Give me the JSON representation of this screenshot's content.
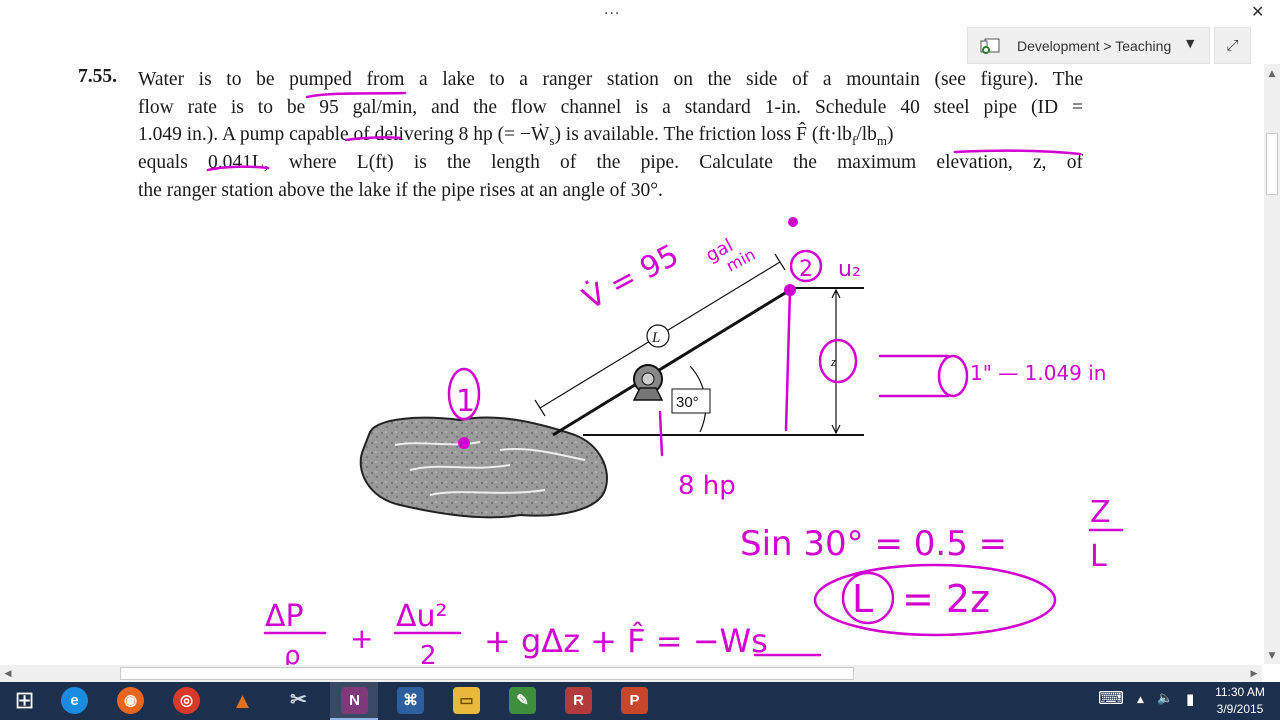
{
  "window": {
    "overflow_label": "...",
    "close_label": "✕",
    "notebook_breadcrumb": "Development > Teaching",
    "breadcrumb_chevron": "▼",
    "expand_label": "⤢"
  },
  "problem": {
    "number": "7.55.",
    "lines": [
      "Water is to be pumped from a lake to a ranger station on the side of a mountain (see figure). The",
      "flow rate is to be 95 gal/min, and the flow channel is a standard 1-in. Schedule 40 steel pipe (ID =",
      "1.049 in.). A pump capable of delivering 8 hp (= −Ẇ",
      "equals 0.041L, where L(ft) is the length of the pipe. Calculate the maximum elevation, z, of",
      "the ranger station above the lake if the pipe rises at an angle of 30°."
    ],
    "line3_tail": ") is available. The friction loss F̂ (ft·lb",
    "line3_sub_s": "s",
    "line3_sub_f": "f",
    "line3_mid": "/lb",
    "line3_sub_m": "m",
    "line3_end": ")"
  },
  "figure": {
    "label_L": "L",
    "label_angle": "30°",
    "label_z": "z"
  },
  "annotations": {
    "point1": "1",
    "point2": "2",
    "u2": "u₂",
    "flow": "V̇ = 95",
    "flow_units_top": "gal",
    "flow_units_bottom": "min",
    "pump_power": "8 hp",
    "pipe_size": "1\" — 1.049 in",
    "sin_eq": "Sin 30° = 0.5 =",
    "frac_num": "Z",
    "frac_den": "L",
    "L_eq_L": "L",
    "L_eq_rest": "= 2z",
    "energy_dp": "ΔP",
    "energy_rho": "ρ",
    "energy_du": "Δu²",
    "energy_2": "2",
    "energy_rest": "+ gΔz + F̂ = −Ws",
    "plus": "+",
    "ink_color": "#d100d1"
  },
  "taskbar": {
    "apps": [
      {
        "name": "start-button",
        "glyph": "⊞",
        "color": "#1c2f4c"
      },
      {
        "name": "internet-explorer",
        "glyph": "e",
        "color": "#1a8be0"
      },
      {
        "name": "firefox",
        "glyph": "◉",
        "color": "#e8661e"
      },
      {
        "name": "chrome",
        "glyph": "◎",
        "color": "#d9392b"
      },
      {
        "name": "matlab",
        "glyph": "▲",
        "color": "#e5701a"
      },
      {
        "name": "snipping-tool",
        "glyph": "✂",
        "color": "#4f6d8f"
      },
      {
        "name": "onenote",
        "glyph": "N",
        "color": "#80397b"
      },
      {
        "name": "network-app",
        "glyph": "⌘",
        "color": "#2d5f9e"
      },
      {
        "name": "file-explorer",
        "glyph": "▭",
        "color": "#e8b93a"
      },
      {
        "name": "paint",
        "glyph": "✎",
        "color": "#3e8e3e"
      },
      {
        "name": "r-app",
        "glyph": "R",
        "color": "#b23a3a"
      },
      {
        "name": "powerpoint",
        "glyph": "P",
        "color": "#c8462c"
      }
    ],
    "time": "11:30 AM",
    "date": "3/9/2015",
    "keyboard_icon": "⌨",
    "chevron_icon": "▲",
    "volume_icon": "🔈",
    "battery_icon": "▮"
  },
  "scrollbars": {
    "up": "▲",
    "down": "▼",
    "left": "◀",
    "right": "▶"
  }
}
